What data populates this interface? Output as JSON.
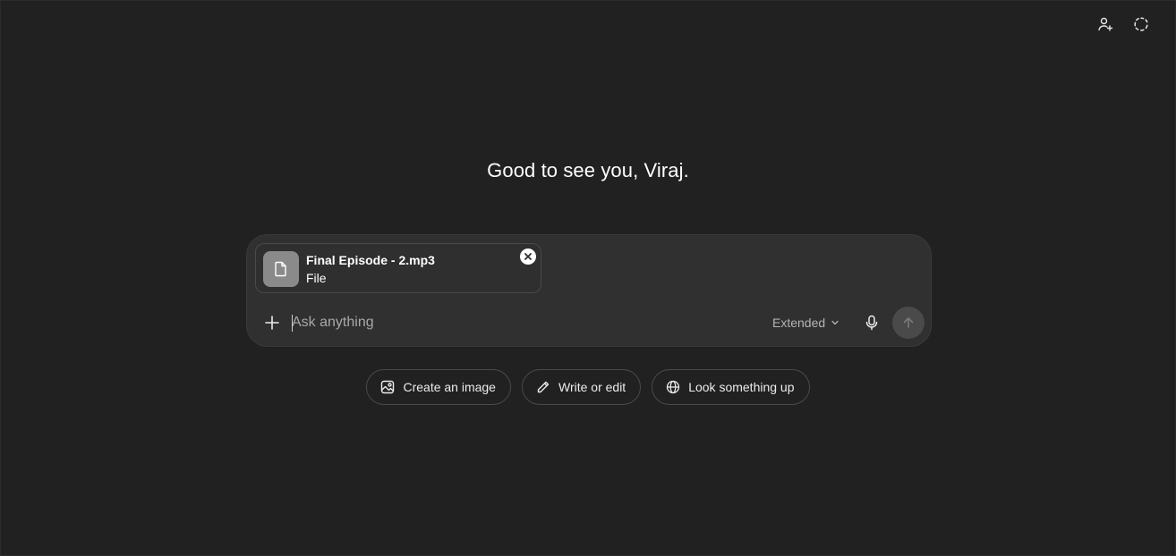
{
  "header": {
    "actions": [
      {
        "name": "add-person-icon",
        "label": "Add people"
      },
      {
        "name": "temporary-chat-icon",
        "label": "Temporary chat"
      }
    ]
  },
  "greeting": "Good to see you, Viraj.",
  "composer": {
    "attachment": {
      "file_name": "Final Episode - 2.mp3",
      "file_type": "File",
      "icon": "document-icon"
    },
    "input": {
      "value": "",
      "placeholder": "Ask anything"
    },
    "mode": {
      "selected": "Extended"
    },
    "icons": {
      "add": "plus-icon",
      "mic": "microphone-icon",
      "send": "arrow-up-icon"
    }
  },
  "suggestions": [
    {
      "label": "Create an image",
      "icon": "image-icon"
    },
    {
      "label": "Write or edit",
      "icon": "pencil-icon"
    },
    {
      "label": "Look something up",
      "icon": "globe-icon"
    }
  ],
  "colors": {
    "background": "#212121",
    "composer": "#303030",
    "text": "#ececec",
    "muted": "#a8a8a8"
  }
}
